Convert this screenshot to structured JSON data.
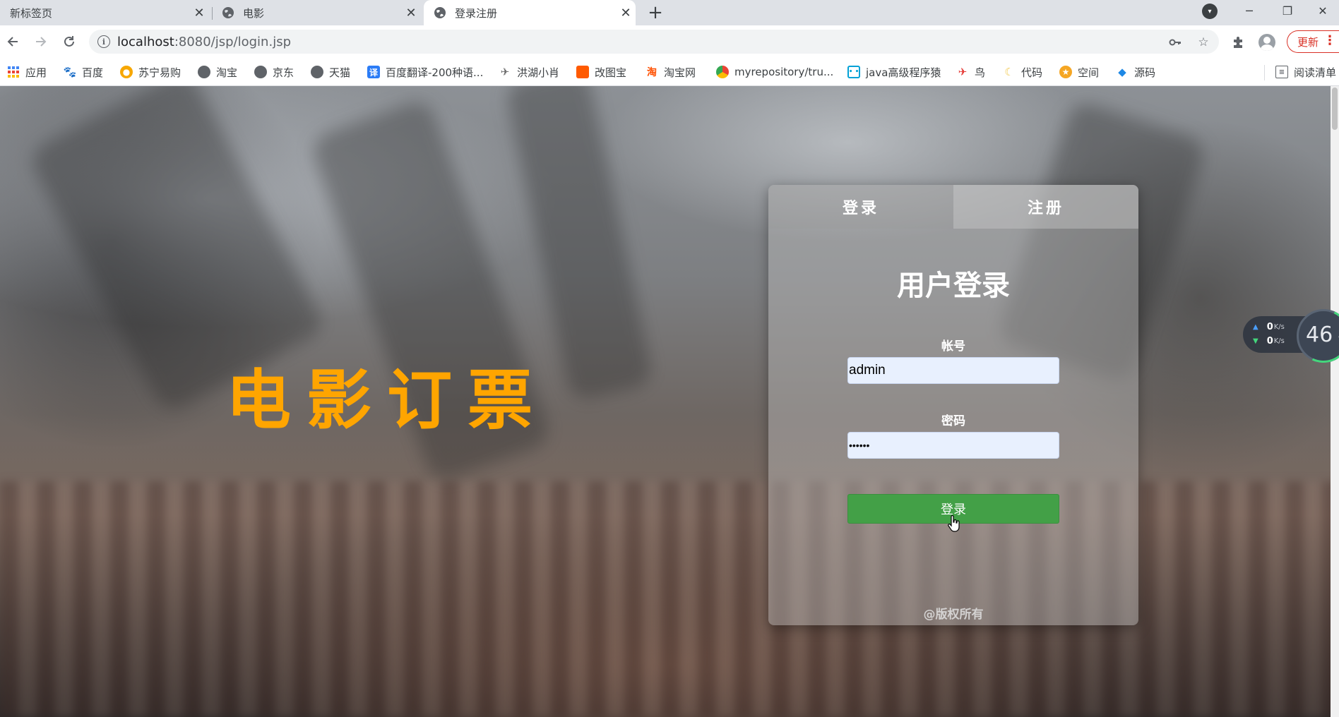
{
  "browser": {
    "tabs": [
      {
        "title": "新标签页",
        "active": false
      },
      {
        "title": "电影",
        "active": false
      },
      {
        "title": "登录注册",
        "active": true
      }
    ],
    "new_tab_symbol": "+",
    "close_symbol": "✕",
    "window_controls": {
      "minimize": "─",
      "restore": "❐",
      "close": "✕"
    },
    "address": {
      "host": "localhost",
      "path": ":8080/jsp/login.jsp"
    },
    "update_label": "更新",
    "bookmarks": [
      {
        "label": "应用",
        "icon": "apps-grid-icon",
        "color": "#4285f4"
      },
      {
        "label": "百度",
        "icon": "baidu-paw-icon",
        "color": "#2932e1"
      },
      {
        "label": "苏宁易购",
        "icon": "suning-icon",
        "color": "#f7a700"
      },
      {
        "label": "淘宝",
        "icon": "globe-icon",
        "color": "#5f6368"
      },
      {
        "label": "京东",
        "icon": "globe-icon",
        "color": "#5f6368"
      },
      {
        "label": "天猫",
        "icon": "globe-icon",
        "color": "#5f6368"
      },
      {
        "label": "百度翻译-200种语...",
        "icon": "translate-icon",
        "color": "#2b7cf6"
      },
      {
        "label": "洪湖小肖",
        "icon": "bird-icon",
        "color": "#8a8a8a"
      },
      {
        "label": "改图宝",
        "icon": "orange-square-icon",
        "color": "#ff5a00"
      },
      {
        "label": "淘宝网",
        "icon": "taobao-icon",
        "color": "#ff5000"
      },
      {
        "label": "myrepository/tru...",
        "icon": "chrome-icon",
        "color": "#34a853"
      },
      {
        "label": "java高级程序猿",
        "icon": "bilibili-icon",
        "color": "#00a1d6"
      },
      {
        "label": "鸟",
        "icon": "bird-red-icon",
        "color": "#e53935"
      },
      {
        "label": "代码",
        "icon": "moon-icon",
        "color": "#f2c94c"
      },
      {
        "label": "空间",
        "icon": "qzone-icon",
        "color": "#f5a623"
      },
      {
        "label": "源码",
        "icon": "fish-icon",
        "color": "#1e88e5"
      }
    ],
    "reading_list": "阅读清单"
  },
  "page": {
    "hero_title": "电影订票",
    "hero_color": "#ffa500",
    "card": {
      "tabs": {
        "login": "登录",
        "register": "注册"
      },
      "heading": "用户登录",
      "account_label": "帐号",
      "account_value": "admin",
      "password_label": "密码",
      "password_value": "••••••",
      "submit_label": "登录",
      "copyright": "@版权所有",
      "button_color": "#43a047"
    }
  },
  "net_widget": {
    "upload": "0",
    "download": "0",
    "unit": "K/s",
    "percent": "46",
    "percent_sign": "%"
  }
}
